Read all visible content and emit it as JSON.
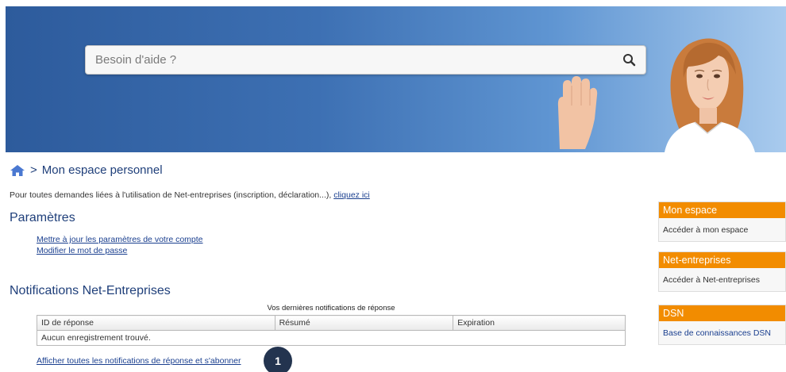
{
  "search": {
    "placeholder": "Besoin d'aide ?",
    "icon": "search-icon"
  },
  "breadcrumb": {
    "home_icon": "home-icon",
    "separator": ">",
    "current": "Mon espace personnel"
  },
  "help": {
    "text": "Pour toutes demandes liées à l'utilisation de Net-entreprises (inscription, déclaration...), ",
    "link": "cliquez ici"
  },
  "params": {
    "title": "Paramètres",
    "links": [
      "Mettre à jour les paramètres de votre compte",
      "Modifier le mot de passe"
    ]
  },
  "notifications": {
    "title": "Notifications Net-Entreprises",
    "caption": "Vos dernières notifications de réponse",
    "columns": [
      "ID de réponse",
      "Résumé",
      "Expiration"
    ],
    "empty": "Aucun enregistrement trouvé.",
    "all_link": "Afficher toutes les notifications de réponse et s'abonner"
  },
  "badge": "1",
  "sidebar": [
    {
      "title": "Mon espace",
      "link": "Accéder à mon espace"
    },
    {
      "title": "Net-entreprises",
      "link": "Accéder à Net-entreprises"
    },
    {
      "title": "DSN",
      "link": "Base de connaissances DSN"
    }
  ],
  "colors": {
    "banner_start": "#2d5b9c",
    "banner_end": "#a9cbee",
    "accent_orange": "#f28c00",
    "title_blue": "#1f3f7a",
    "link_blue": "#1a3f8f",
    "badge": "#23344f"
  }
}
